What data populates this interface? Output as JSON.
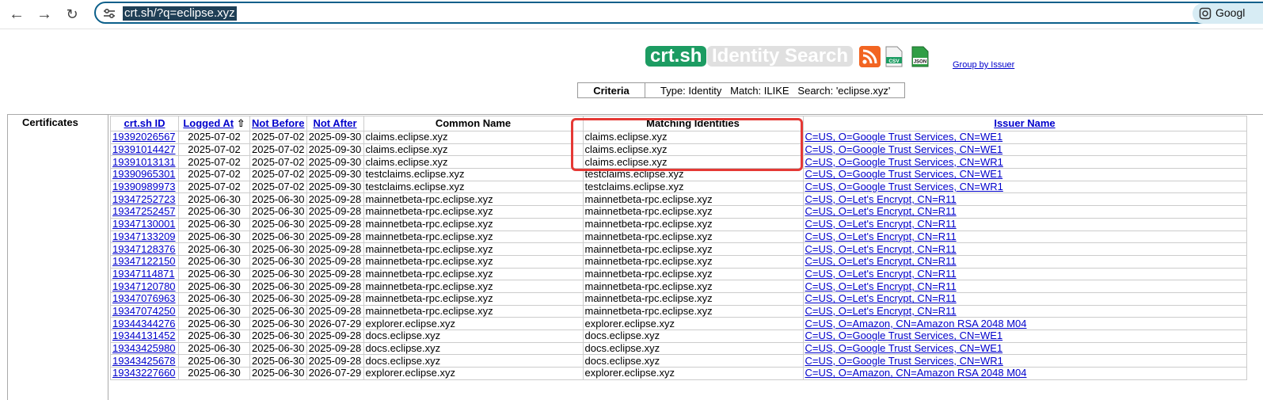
{
  "browser": {
    "url": "crt.sh/?q=eclipse.xyz",
    "search_pill_label": "Googl"
  },
  "header": {
    "brand": "crt.sh",
    "title": "Identity Search",
    "group_link": "Group by Issuer",
    "icons": [
      "rss-icon",
      "csv-icon",
      "json-icon"
    ]
  },
  "criteria": {
    "label": "Criteria",
    "text": "Type: Identity   Match: ILIKE   Search: 'eclipse.xyz'"
  },
  "results": {
    "section_label": "Certificates",
    "columns": [
      "crt.sh ID",
      "Logged At",
      "Not Before",
      "Not After",
      "Common Name",
      "Matching Identities",
      "Issuer Name"
    ],
    "sort_indicator": "⇧",
    "rows": [
      [
        "19392026567",
        "2025-07-02",
        "2025-07-02",
        "2025-09-30",
        "claims.eclipse.xyz",
        "claims.eclipse.xyz",
        "C=US, O=Google Trust Services, CN=WE1"
      ],
      [
        "19391014427",
        "2025-07-02",
        "2025-07-02",
        "2025-09-30",
        "claims.eclipse.xyz",
        "claims.eclipse.xyz",
        "C=US, O=Google Trust Services, CN=WE1"
      ],
      [
        "19391013131",
        "2025-07-02",
        "2025-07-02",
        "2025-09-30",
        "claims.eclipse.xyz",
        "claims.eclipse.xyz",
        "C=US, O=Google Trust Services, CN=WR1"
      ],
      [
        "19390965301",
        "2025-07-02",
        "2025-07-02",
        "2025-09-30",
        "testclaims.eclipse.xyz",
        "testclaims.eclipse.xyz",
        "C=US, O=Google Trust Services, CN=WE1"
      ],
      [
        "19390989973",
        "2025-07-02",
        "2025-07-02",
        "2025-09-30",
        "testclaims.eclipse.xyz",
        "testclaims.eclipse.xyz",
        "C=US, O=Google Trust Services, CN=WR1"
      ],
      [
        "19347252723",
        "2025-06-30",
        "2025-06-30",
        "2025-09-28",
        "mainnetbeta-rpc.eclipse.xyz",
        "mainnetbeta-rpc.eclipse.xyz",
        "C=US, O=Let's Encrypt, CN=R11"
      ],
      [
        "19347252457",
        "2025-06-30",
        "2025-06-30",
        "2025-09-28",
        "mainnetbeta-rpc.eclipse.xyz",
        "mainnetbeta-rpc.eclipse.xyz",
        "C=US, O=Let's Encrypt, CN=R11"
      ],
      [
        "19347130001",
        "2025-06-30",
        "2025-06-30",
        "2025-09-28",
        "mainnetbeta-rpc.eclipse.xyz",
        "mainnetbeta-rpc.eclipse.xyz",
        "C=US, O=Let's Encrypt, CN=R11"
      ],
      [
        "19347133209",
        "2025-06-30",
        "2025-06-30",
        "2025-09-28",
        "mainnetbeta-rpc.eclipse.xyz",
        "mainnetbeta-rpc.eclipse.xyz",
        "C=US, O=Let's Encrypt, CN=R11"
      ],
      [
        "19347128376",
        "2025-06-30",
        "2025-06-30",
        "2025-09-28",
        "mainnetbeta-rpc.eclipse.xyz",
        "mainnetbeta-rpc.eclipse.xyz",
        "C=US, O=Let's Encrypt, CN=R11"
      ],
      [
        "19347122150",
        "2025-06-30",
        "2025-06-30",
        "2025-09-28",
        "mainnetbeta-rpc.eclipse.xyz",
        "mainnetbeta-rpc.eclipse.xyz",
        "C=US, O=Let's Encrypt, CN=R11"
      ],
      [
        "19347114871",
        "2025-06-30",
        "2025-06-30",
        "2025-09-28",
        "mainnetbeta-rpc.eclipse.xyz",
        "mainnetbeta-rpc.eclipse.xyz",
        "C=US, O=Let's Encrypt, CN=R11"
      ],
      [
        "19347120780",
        "2025-06-30",
        "2025-06-30",
        "2025-09-28",
        "mainnetbeta-rpc.eclipse.xyz",
        "mainnetbeta-rpc.eclipse.xyz",
        "C=US, O=Let's Encrypt, CN=R11"
      ],
      [
        "19347076963",
        "2025-06-30",
        "2025-06-30",
        "2025-09-28",
        "mainnetbeta-rpc.eclipse.xyz",
        "mainnetbeta-rpc.eclipse.xyz",
        "C=US, O=Let's Encrypt, CN=R11"
      ],
      [
        "19347074250",
        "2025-06-30",
        "2025-06-30",
        "2025-09-28",
        "mainnetbeta-rpc.eclipse.xyz",
        "mainnetbeta-rpc.eclipse.xyz",
        "C=US, O=Let's Encrypt, CN=R11"
      ],
      [
        "19344344276",
        "2025-06-30",
        "2025-06-30",
        "2026-07-29",
        "explorer.eclipse.xyz",
        "explorer.eclipse.xyz",
        "C=US, O=Amazon, CN=Amazon RSA 2048 M04"
      ],
      [
        "19344131452",
        "2025-06-30",
        "2025-06-30",
        "2025-09-28",
        "docs.eclipse.xyz",
        "docs.eclipse.xyz",
        "C=US, O=Google Trust Services, CN=WE1"
      ],
      [
        "19343425980",
        "2025-06-30",
        "2025-06-30",
        "2025-09-28",
        "docs.eclipse.xyz",
        "docs.eclipse.xyz",
        "C=US, O=Google Trust Services, CN=WE1"
      ],
      [
        "19343425678",
        "2025-06-30",
        "2025-06-30",
        "2025-09-28",
        "docs.eclipse.xyz",
        "docs.eclipse.xyz",
        "C=US, O=Google Trust Services, CN=WR1"
      ],
      [
        "19343227660",
        "2025-06-30",
        "2025-06-30",
        "2026-07-29",
        "explorer.eclipse.xyz",
        "explorer.eclipse.xyz",
        "C=US, O=Amazon, CN=Amazon RSA 2048 M04"
      ]
    ]
  },
  "colors": {
    "brand_green": "#1c9c62",
    "link_blue": "#0000cc",
    "highlight_red": "#e53935"
  }
}
